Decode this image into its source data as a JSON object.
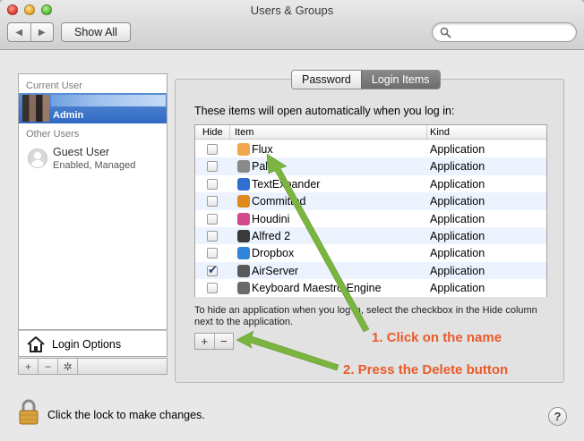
{
  "window": {
    "title": "Users & Groups"
  },
  "toolbar": {
    "back_glyph": "◀",
    "forward_glyph": "▶",
    "show_all_label": "Show All",
    "search_value": "",
    "search_placeholder": ""
  },
  "users": {
    "current_user_heading": "Current User",
    "admin_label": "Admin",
    "other_users_heading": "Other Users",
    "guest_name": "Guest User",
    "guest_status": "Enabled, Managed",
    "login_options_label": "Login Options",
    "bar_buttons": [
      "+",
      "−",
      "✲"
    ]
  },
  "tabs": {
    "password": "Password",
    "login_items": "Login Items",
    "active": "login_items"
  },
  "login_items": {
    "intro": "These items will open automatically when you log in:",
    "columns": {
      "hide": "Hide",
      "item": "Item",
      "kind": "Kind"
    },
    "rows": [
      {
        "name": "Flux",
        "kind": "Application",
        "hidden": false,
        "icon": "flux-icon",
        "color": "#f0a64a"
      },
      {
        "name": "Pal",
        "kind": "Application",
        "hidden": false,
        "icon": "pal-icon",
        "color": "#8a8a8a"
      },
      {
        "name": "TextExpander",
        "kind": "Application",
        "hidden": false,
        "icon": "textexpander-icon",
        "color": "#2f6fd0"
      },
      {
        "name": "Committed",
        "kind": "Application",
        "hidden": false,
        "icon": "committed-icon",
        "color": "#e08a1e"
      },
      {
        "name": "Houdini",
        "kind": "Application",
        "hidden": false,
        "icon": "houdini-icon",
        "color": "#d24a8a"
      },
      {
        "name": "Alfred 2",
        "kind": "Application",
        "hidden": false,
        "icon": "alfred-icon",
        "color": "#3a3a3a"
      },
      {
        "name": "Dropbox",
        "kind": "Application",
        "hidden": false,
        "icon": "dropbox-icon",
        "color": "#2f84d8"
      },
      {
        "name": "AirServer",
        "kind": "Application",
        "hidden": true,
        "icon": "airserver-icon",
        "color": "#5a5a5a"
      },
      {
        "name": "Keyboard Maestro Engine",
        "kind": "Application",
        "hidden": false,
        "icon": "keyboard-maestro-icon",
        "color": "#6a6a6a"
      }
    ],
    "hint": "To hide an application when you log in, select the checkbox in the Hide column next to the application.",
    "add_label": "+",
    "remove_label": "−"
  },
  "annotations": {
    "step1": "1. Click on the name",
    "step2": "2. Press the Delete button",
    "color": "#ea5a2b",
    "arrow_color": "#79b53f"
  },
  "footer": {
    "lock_text": "Click the lock to make changes.",
    "help_label": "?"
  }
}
